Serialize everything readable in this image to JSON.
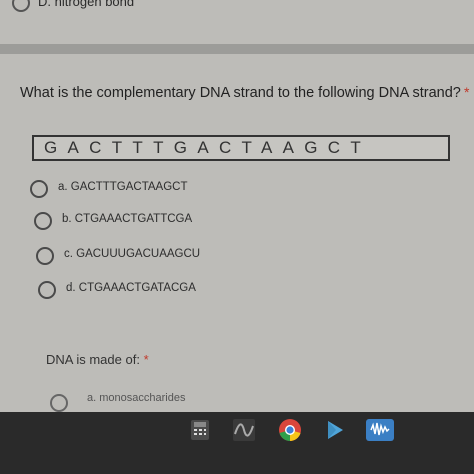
{
  "previous_question": {
    "option_d": "D. nitrogen bond"
  },
  "question1": {
    "text": "What is the complementary DNA strand to the following DNA strand?",
    "required_mark": "*",
    "strand": "GACTTTGACTAAGCT",
    "options": [
      {
        "label": "a. GACTTTGACTAAGCT"
      },
      {
        "label": "b. CTGAAACTGATTCGA"
      },
      {
        "label": "c. GACUUUGACUAAGCU"
      },
      {
        "label": "d. CTGAAACTGATACGA"
      }
    ]
  },
  "question2": {
    "text": "DNA is made of:",
    "required_mark": "*",
    "options": [
      {
        "label": "a. monosaccharides"
      }
    ]
  },
  "taskbar": {
    "icons": [
      "calculator-icon",
      "graph-icon",
      "chrome-icon",
      "play-store-icon",
      "audio-icon"
    ]
  },
  "colors": {
    "background": "#bdbcb8",
    "required": "#c0392b",
    "taskbar": "#2a2a2a"
  }
}
